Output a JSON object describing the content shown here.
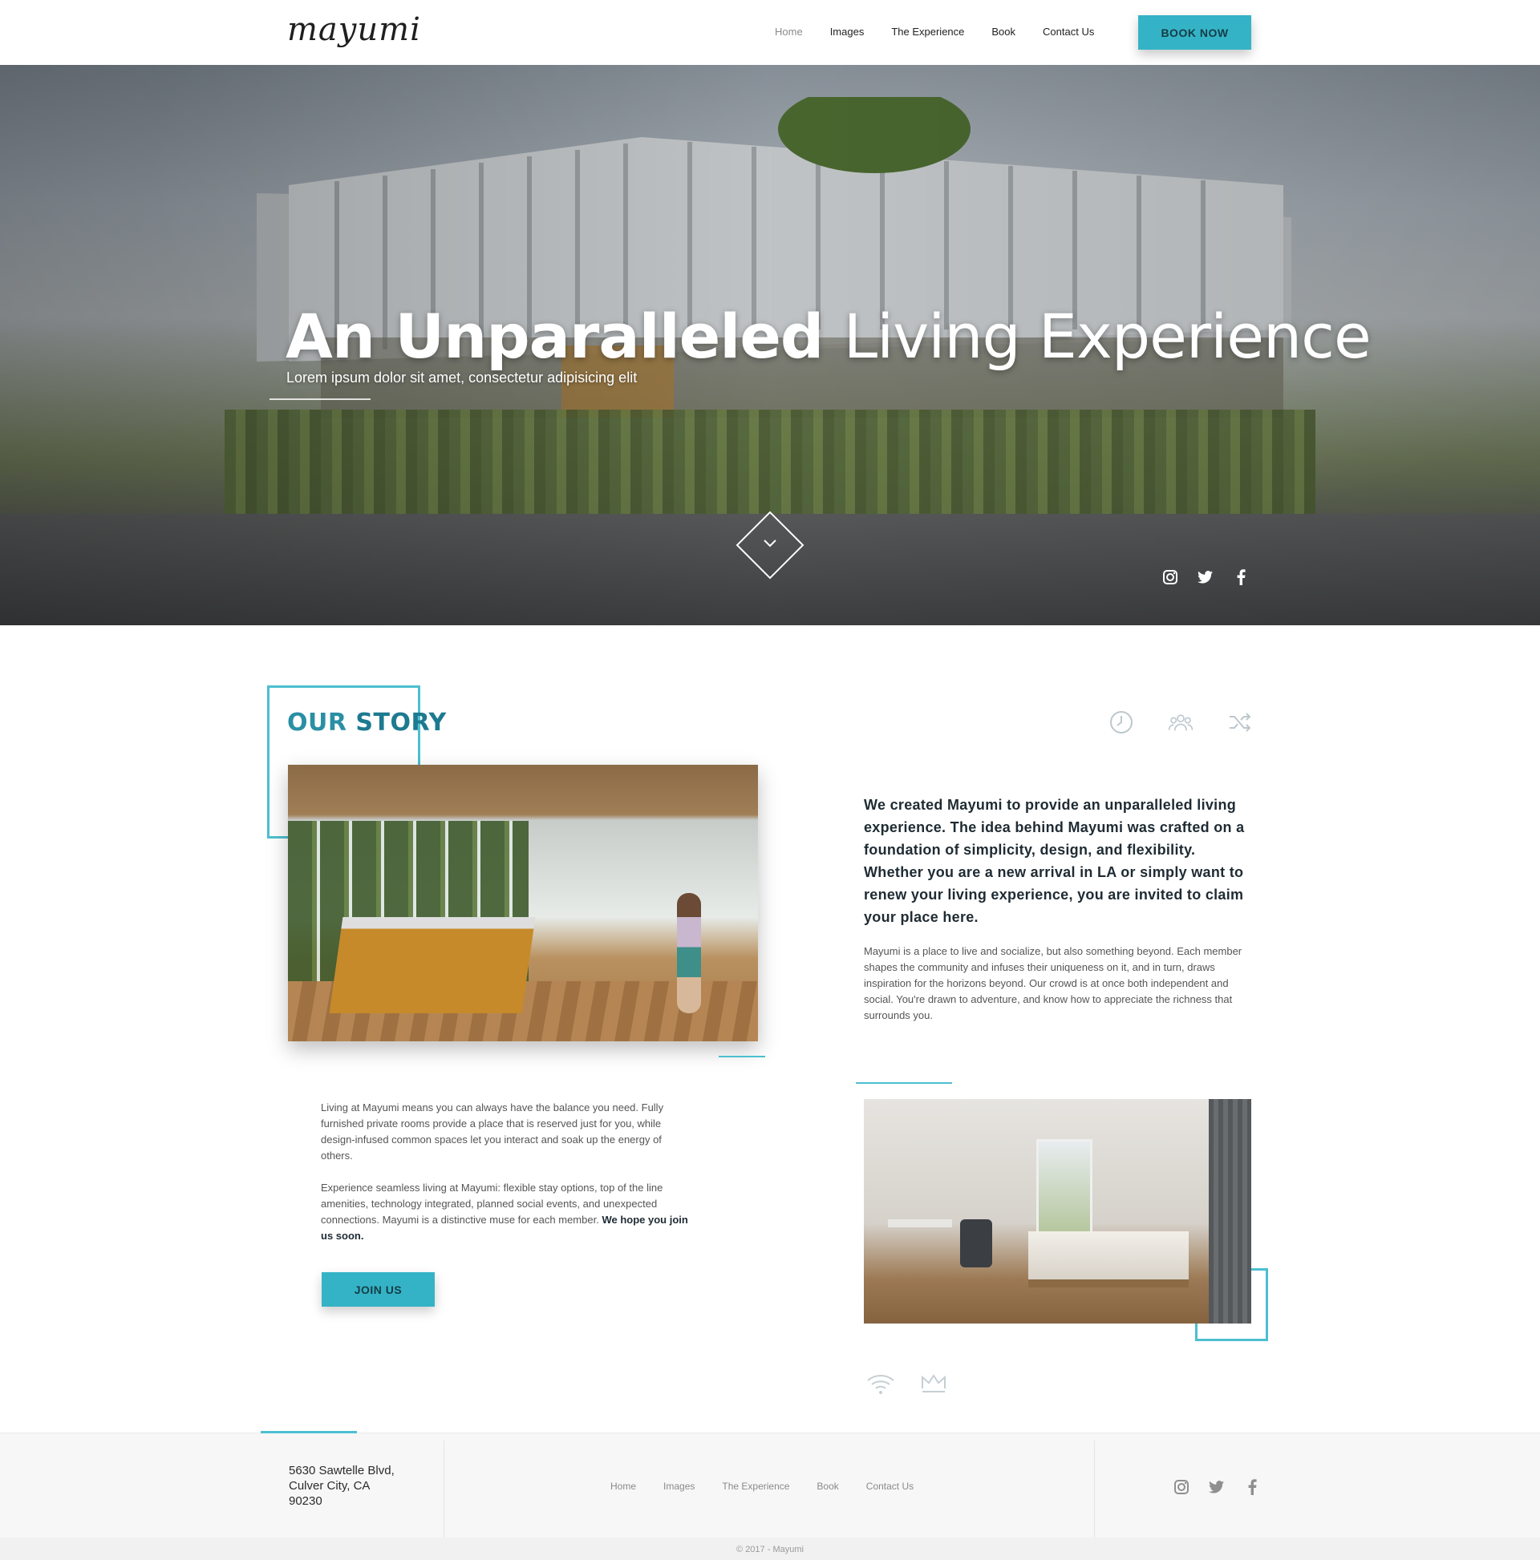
{
  "header": {
    "logo": "mayumi",
    "nav": [
      "Home",
      "Images",
      "The Experience",
      "Book",
      "Contact Us"
    ],
    "active_nav": "Home",
    "cta": "BOOK NOW"
  },
  "hero": {
    "title_bold": "An Unparalleled",
    "title_light": "Living Experience",
    "subtitle": "Lorem ipsum dolor sit amet, consectetur adipisicing elit",
    "social": [
      "instagram-icon",
      "twitter-icon",
      "facebook-icon"
    ]
  },
  "story": {
    "title_light": "OUR",
    "title_bold": "STORY",
    "icons": [
      "clock-icon",
      "people-icon",
      "shuffle-icon"
    ],
    "lead": "We created Mayumi to provide an unparalleled living experience. The idea behind Mayumi was crafted on a foundation of simplicity, design, and flexibility. Whether you are a new arrival in LA or simply want to renew your living experience, you are invited to claim your place here.",
    "body": "Mayumi is a place to live and socialize, but also something beyond. Each member shapes the community and infuses their uniqueness on it, and in turn, draws inspiration for the horizons beyond. Our crowd is at once both independent and social. You're drawn to adventure, and know how to appreciate the richness that surrounds you.",
    "paragraph_1": "Living at Mayumi means you can always have the balance you need. Fully furnished private rooms provide a place that is reserved just for you, while design-infused common spaces let you interact and soak up the energy of others.",
    "paragraph_2": "Experience seamless living at Mayumi: flexible stay options, top of the line amenities, technology integrated, planned social events, and unexpected connections. Mayumi is a distinctive muse for each member.",
    "paragraph_2_bold": "We hope you join us soon.",
    "join_button": "JOIN US",
    "amenity_icons": [
      "wifi-icon",
      "crown-icon"
    ]
  },
  "footer": {
    "address_line_1": "5630 Sawtelle Blvd,",
    "address_line_2": "Culver City, CA",
    "address_line_3": "90230",
    "nav": [
      "Home",
      "Images",
      "The Experience",
      "Book",
      "Contact Us"
    ],
    "social": [
      "instagram-icon",
      "twitter-icon",
      "facebook-icon"
    ],
    "copyright": "© 2017 - Mayumi"
  },
  "colors": {
    "accent": "#35b3c6",
    "accent_dark": "#1d7a90",
    "text": "#2b2b2b"
  }
}
